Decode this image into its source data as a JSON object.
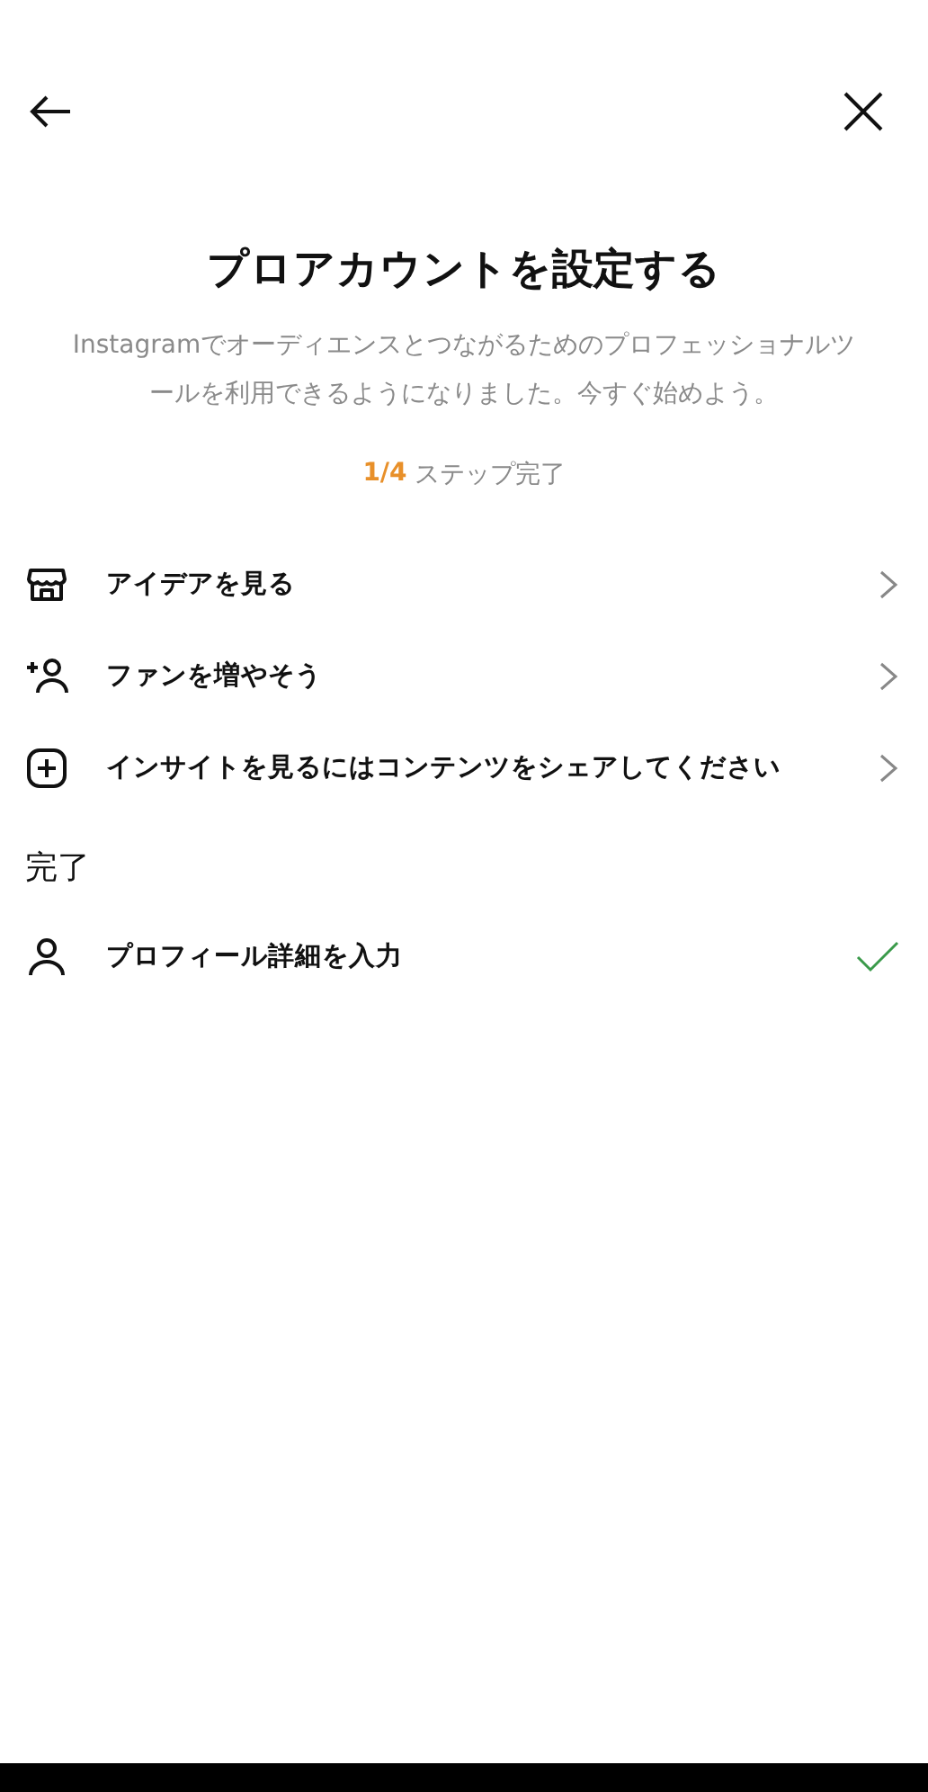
{
  "title": "プロアカウントを設定する",
  "description": "Instagramでオーディエンスとつながるためのプロフェッショナルツールを利用できるようになりました。今すぐ始めよう。",
  "progress": {
    "count": "1/4",
    "label": "ステップ完了"
  },
  "steps": [
    {
      "kind": "shop",
      "label": "アイデアを見る",
      "completed": false
    },
    {
      "kind": "add-person",
      "label": "ファンを増やそう",
      "completed": false
    },
    {
      "kind": "add-square",
      "label": "インサイトを見るにはコンテンツをシェアしてください",
      "completed": false
    }
  ],
  "completed_section": {
    "heading": "完了",
    "steps": [
      {
        "kind": "person",
        "label": "プロフィール詳細を入力",
        "completed": true
      }
    ]
  }
}
